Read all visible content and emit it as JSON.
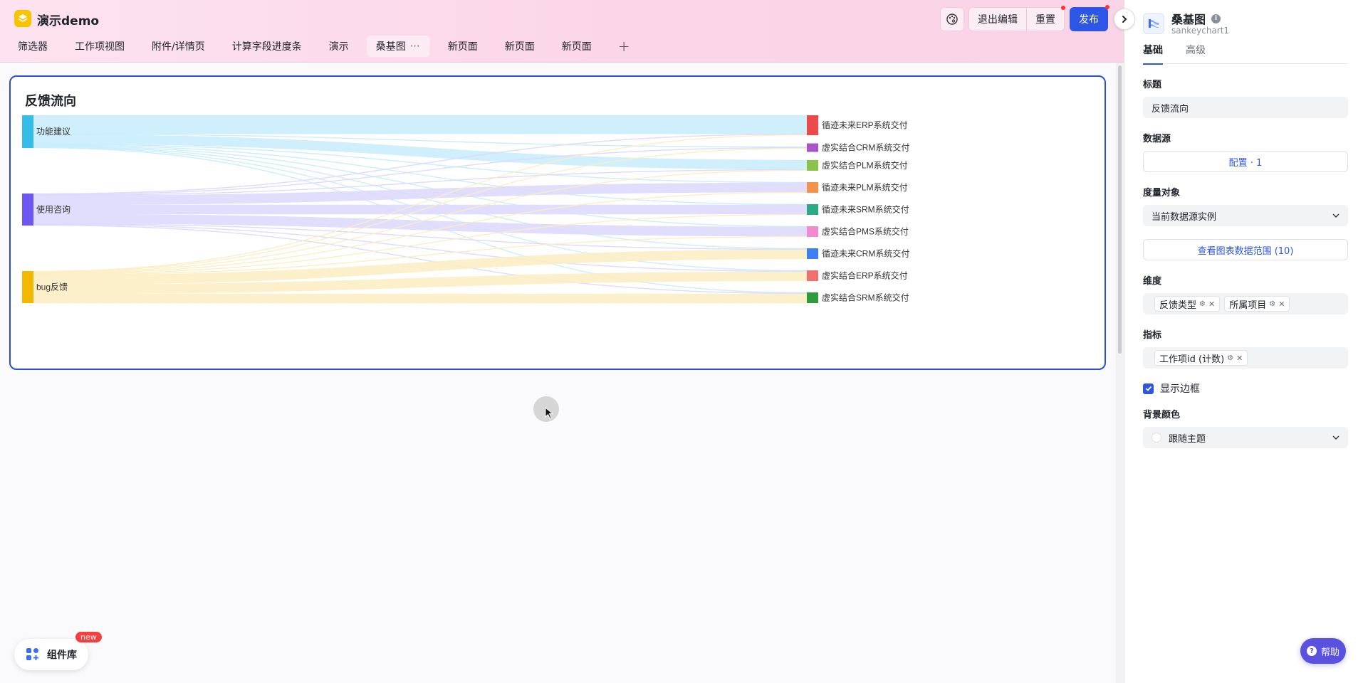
{
  "app": {
    "title": "演示demo"
  },
  "tabs": [
    {
      "label": "筛选器"
    },
    {
      "label": "工作项视图"
    },
    {
      "label": "附件/详情页"
    },
    {
      "label": "计算字段进度条"
    },
    {
      "label": "演示"
    },
    {
      "label": "桑基图",
      "active": true,
      "more": "⋯"
    },
    {
      "label": "新页面"
    },
    {
      "label": "新页面"
    },
    {
      "label": "新页面"
    }
  ],
  "tab_add": "+",
  "toolbar": {
    "exit_edit": "退出编辑",
    "reset": "重置",
    "publish": "发布"
  },
  "chart_card": {
    "title": "反馈流向"
  },
  "chart_data": {
    "type": "sankey",
    "title": "反馈流向",
    "sources": [
      {
        "name": "功能建议",
        "color": "#35bce8",
        "flow_color": "#c8ecfb"
      },
      {
        "name": "使用咨询",
        "color": "#6e56f2",
        "flow_color": "#dcd8fd"
      },
      {
        "name": "bug反馈",
        "color": "#f5b800",
        "flow_color": "#fcedc2"
      }
    ],
    "targets": [
      {
        "name": "循迹未来ERP系统交付",
        "color": "#ec4a4a"
      },
      {
        "name": "虚实结合CRM系统交付",
        "color": "#a755c7"
      },
      {
        "name": "虚实结合PLM系统交付",
        "color": "#8bc34a"
      },
      {
        "name": "循迹未来PLM系统交付",
        "color": "#f5924a"
      },
      {
        "name": "循迹未来SRM系统交付",
        "color": "#2bab84"
      },
      {
        "name": "虚实结合PMS系统交付",
        "color": "#f28ad3"
      },
      {
        "name": "循迹未来CRM系统交付",
        "color": "#3b7ef5"
      },
      {
        "name": "虚实结合ERP系统交付",
        "color": "#f07070"
      },
      {
        "name": "虚实结合SRM系统交付",
        "color": "#2e9c3a"
      }
    ],
    "links": [
      {
        "source": 0,
        "target": 0,
        "value": 8
      },
      {
        "source": 0,
        "target": 2,
        "value": 4
      },
      {
        "source": 0,
        "target": 1,
        "value": 0.3
      },
      {
        "source": 0,
        "target": 3,
        "value": 0.3
      },
      {
        "source": 0,
        "target": 4,
        "value": 0.3
      },
      {
        "source": 0,
        "target": 5,
        "value": 0.3
      },
      {
        "source": 0,
        "target": 6,
        "value": 0.3
      },
      {
        "source": 0,
        "target": 7,
        "value": 0.3
      },
      {
        "source": 0,
        "target": 8,
        "value": 0.3
      },
      {
        "source": 1,
        "target": 3,
        "value": 4
      },
      {
        "source": 1,
        "target": 4,
        "value": 4
      },
      {
        "source": 1,
        "target": 5,
        "value": 4
      },
      {
        "source": 1,
        "target": 0,
        "value": 0.3
      },
      {
        "source": 1,
        "target": 1,
        "value": 0.3
      },
      {
        "source": 1,
        "target": 2,
        "value": 0.3
      },
      {
        "source": 1,
        "target": 6,
        "value": 0.3
      },
      {
        "source": 1,
        "target": 7,
        "value": 0.3
      },
      {
        "source": 1,
        "target": 8,
        "value": 0.3
      },
      {
        "source": 2,
        "target": 6,
        "value": 4
      },
      {
        "source": 2,
        "target": 7,
        "value": 4
      },
      {
        "source": 2,
        "target": 8,
        "value": 4
      },
      {
        "source": 2,
        "target": 0,
        "value": 0.3
      },
      {
        "source": 2,
        "target": 1,
        "value": 0.3
      },
      {
        "source": 2,
        "target": 2,
        "value": 0.3
      },
      {
        "source": 2,
        "target": 3,
        "value": 0.3
      },
      {
        "source": 2,
        "target": 4,
        "value": 0.3
      },
      {
        "source": 2,
        "target": 5,
        "value": 0.3
      }
    ]
  },
  "components_button": {
    "label": "组件库",
    "badge": "new"
  },
  "panel": {
    "title": "桑基图",
    "subtitle": "sankeychart1",
    "tabs": [
      "基础",
      "高级"
    ],
    "title_label": "标题",
    "title_value": "反馈流向",
    "datasource_label": "数据源",
    "datasource_button": "配置 · 1",
    "measure_label": "度量对象",
    "measure_value": "当前数据源实例",
    "view_range_button": "查看图表数据范围 (10)",
    "dimension_label": "维度",
    "dimensions": [
      "反馈类型",
      "所属项目"
    ],
    "metric_label": "指标",
    "metrics": [
      "工作项id (计数)"
    ],
    "show_border_label": "显示边框",
    "show_border": true,
    "bg_label": "背景颜色",
    "bg_value": "跟随主题"
  },
  "help": {
    "label": "帮助"
  },
  "colors": {
    "accent": "#2d55e6",
    "publish": "#2d55e6",
    "help": "#5b51e0",
    "topbar": "#fbd6e8"
  }
}
